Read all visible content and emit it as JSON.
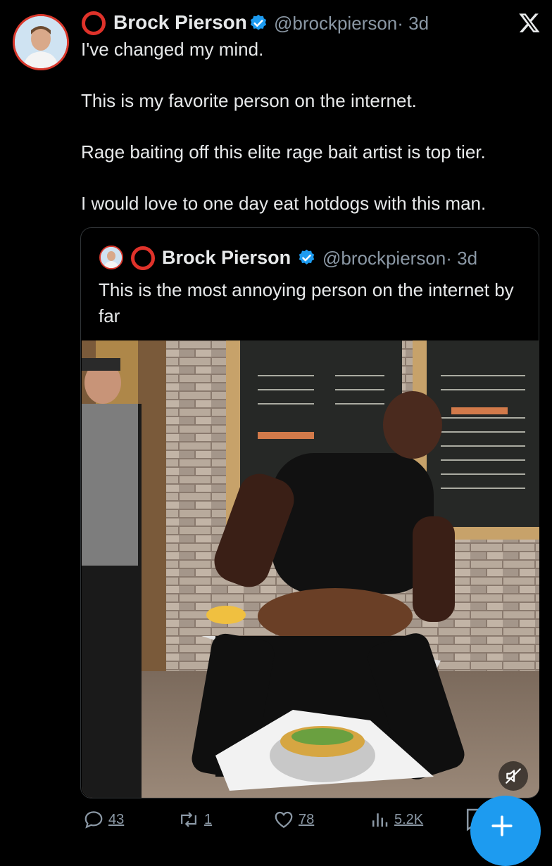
{
  "header": {
    "author_name": "Brock Pierson",
    "handle": "@brockpierson",
    "time": "· 3d",
    "close_icon": "x-logo-icon"
  },
  "tweet": {
    "lines": [
      "I've changed my mind.",
      "This is my favorite person on the internet.",
      "Rage baiting off this elite rage bait artist is top tier.",
      "I would love to one day eat hotdogs with this man."
    ]
  },
  "quote": {
    "author_name": "Brock Pierson",
    "handle": "@brockpierson",
    "time": "· 3d",
    "text": "This is the most annoying person on the internet by far"
  },
  "actions": {
    "replies": "43",
    "reposts": "1",
    "likes": "78",
    "views": "5.2K"
  },
  "colors": {
    "accent": "#1d9bf0",
    "verified": "#1d9bf0",
    "ring": "#e0322a",
    "muted": "#8b98a5"
  },
  "icons": [
    "reply-icon",
    "repost-icon",
    "like-icon",
    "views-icon",
    "bookmark-icon",
    "mute-icon",
    "compose-plus-icon",
    "verified-badge-icon"
  ]
}
